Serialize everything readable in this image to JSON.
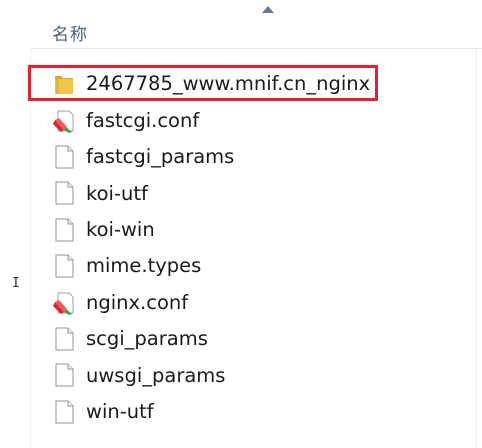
{
  "header": {
    "name_column_label": "名称"
  },
  "files": [
    {
      "name": "2467785_www.mnif.cn_nginx",
      "icon": "folder-icon",
      "highlighted": true
    },
    {
      "name": "fastcgi.conf",
      "icon": "conf-file-icon"
    },
    {
      "name": "fastcgi_params",
      "icon": "file-icon"
    },
    {
      "name": "koi-utf",
      "icon": "file-icon"
    },
    {
      "name": "koi-win",
      "icon": "file-icon"
    },
    {
      "name": "mime.types",
      "icon": "file-icon"
    },
    {
      "name": "nginx.conf",
      "icon": "conf-file-icon"
    },
    {
      "name": "scgi_params",
      "icon": "file-icon"
    },
    {
      "name": "uwsgi_params",
      "icon": "file-icon"
    },
    {
      "name": "win-utf",
      "icon": "file-icon"
    }
  ],
  "colors": {
    "highlight_border": "#e8212b",
    "folder": "#e6b83a",
    "header_text": "#4d6082"
  }
}
